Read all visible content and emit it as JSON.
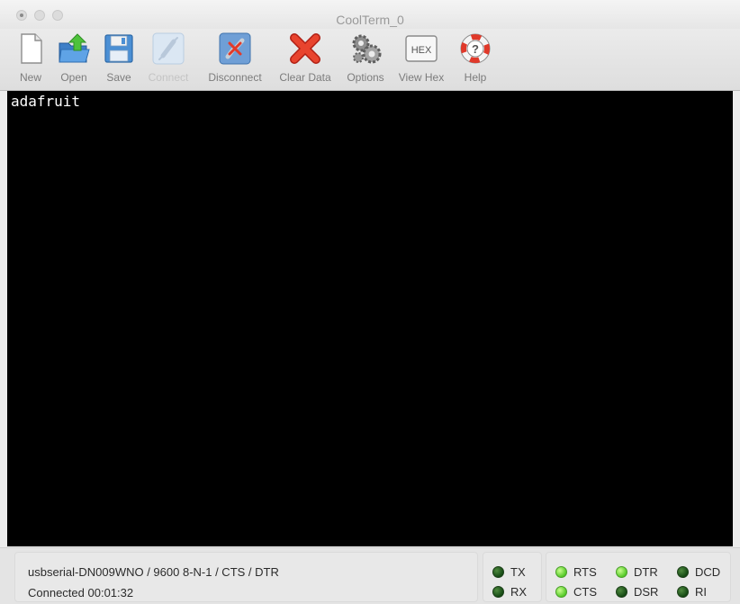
{
  "window": {
    "title": "CoolTerm_0"
  },
  "toolbar": {
    "buttons": [
      {
        "label": "New",
        "icon": "new-document-icon",
        "enabled": true
      },
      {
        "label": "Open",
        "icon": "open-folder-icon",
        "enabled": true
      },
      {
        "label": "Save",
        "icon": "save-disk-icon",
        "enabled": true
      },
      {
        "label": "Connect",
        "icon": "connect-plug-icon",
        "enabled": false
      },
      {
        "label": "Disconnect",
        "icon": "disconnect-plug-icon",
        "enabled": true
      },
      {
        "label": "Clear Data",
        "icon": "clear-x-icon",
        "enabled": true
      },
      {
        "label": "Options",
        "icon": "gears-icon",
        "enabled": true
      },
      {
        "label": "View Hex",
        "icon": "hex-icon",
        "enabled": true,
        "icon_text": "HEX"
      },
      {
        "label": "Help",
        "icon": "lifebuoy-help-icon",
        "enabled": true
      }
    ]
  },
  "terminal": {
    "text": "adafruit",
    "background": "#000000",
    "foreground": "#ffffff"
  },
  "status": {
    "port_settings": "usbserial-DN009WNO / 9600 8-N-1 / CTS / DTR",
    "connection": "Connected 00:01:32",
    "leds": {
      "tx": {
        "label": "TX",
        "on": false
      },
      "rx": {
        "label": "RX",
        "on": false
      },
      "rts": {
        "label": "RTS",
        "on": true
      },
      "cts": {
        "label": "CTS",
        "on": true
      },
      "dtr": {
        "label": "DTR",
        "on": true
      },
      "dsr": {
        "label": "DSR",
        "on": false
      },
      "dcd": {
        "label": "DCD",
        "on": false
      },
      "ri": {
        "label": "RI",
        "on": false
      }
    }
  },
  "colors": {
    "led_on": "#7ee040",
    "led_off": "#2a6a22",
    "terminal_bg": "#000000"
  }
}
